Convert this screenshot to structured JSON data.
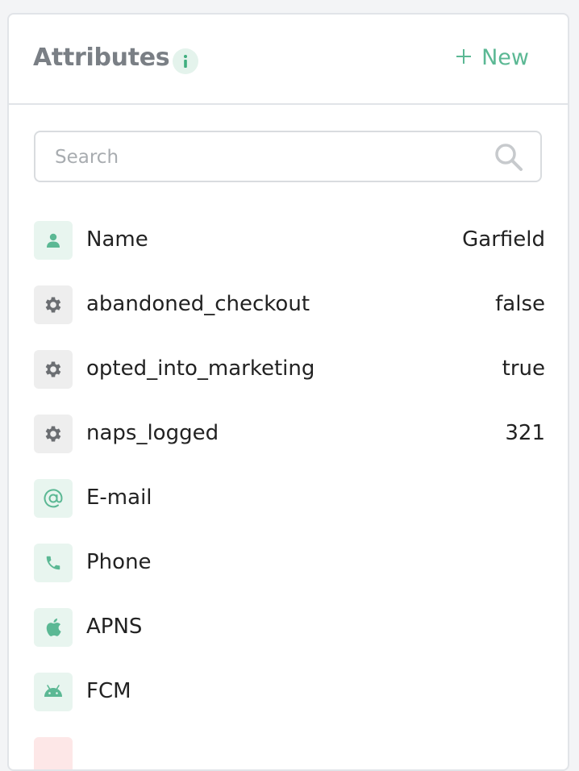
{
  "header": {
    "title": "Attributes",
    "new_label": "New"
  },
  "search": {
    "placeholder": "Search",
    "value": ""
  },
  "colors": {
    "accent": "#5bb894",
    "icon_gray": "#6b6e72"
  },
  "attributes": [
    {
      "name": "Name",
      "value": "Garfield",
      "icon": "person-icon"
    },
    {
      "name": "abandoned_checkout",
      "value": "false",
      "icon": "gear-icon"
    },
    {
      "name": "opted_into_marketing",
      "value": "true",
      "icon": "gear-icon"
    },
    {
      "name": "naps_logged",
      "value": "321",
      "icon": "gear-icon"
    },
    {
      "name": "E-mail",
      "value": "",
      "icon": "at-icon"
    },
    {
      "name": "Phone",
      "value": "",
      "icon": "phone-icon"
    },
    {
      "name": "APNS",
      "value": "",
      "icon": "apple-icon"
    },
    {
      "name": "FCM",
      "value": "",
      "icon": "android-icon"
    }
  ]
}
